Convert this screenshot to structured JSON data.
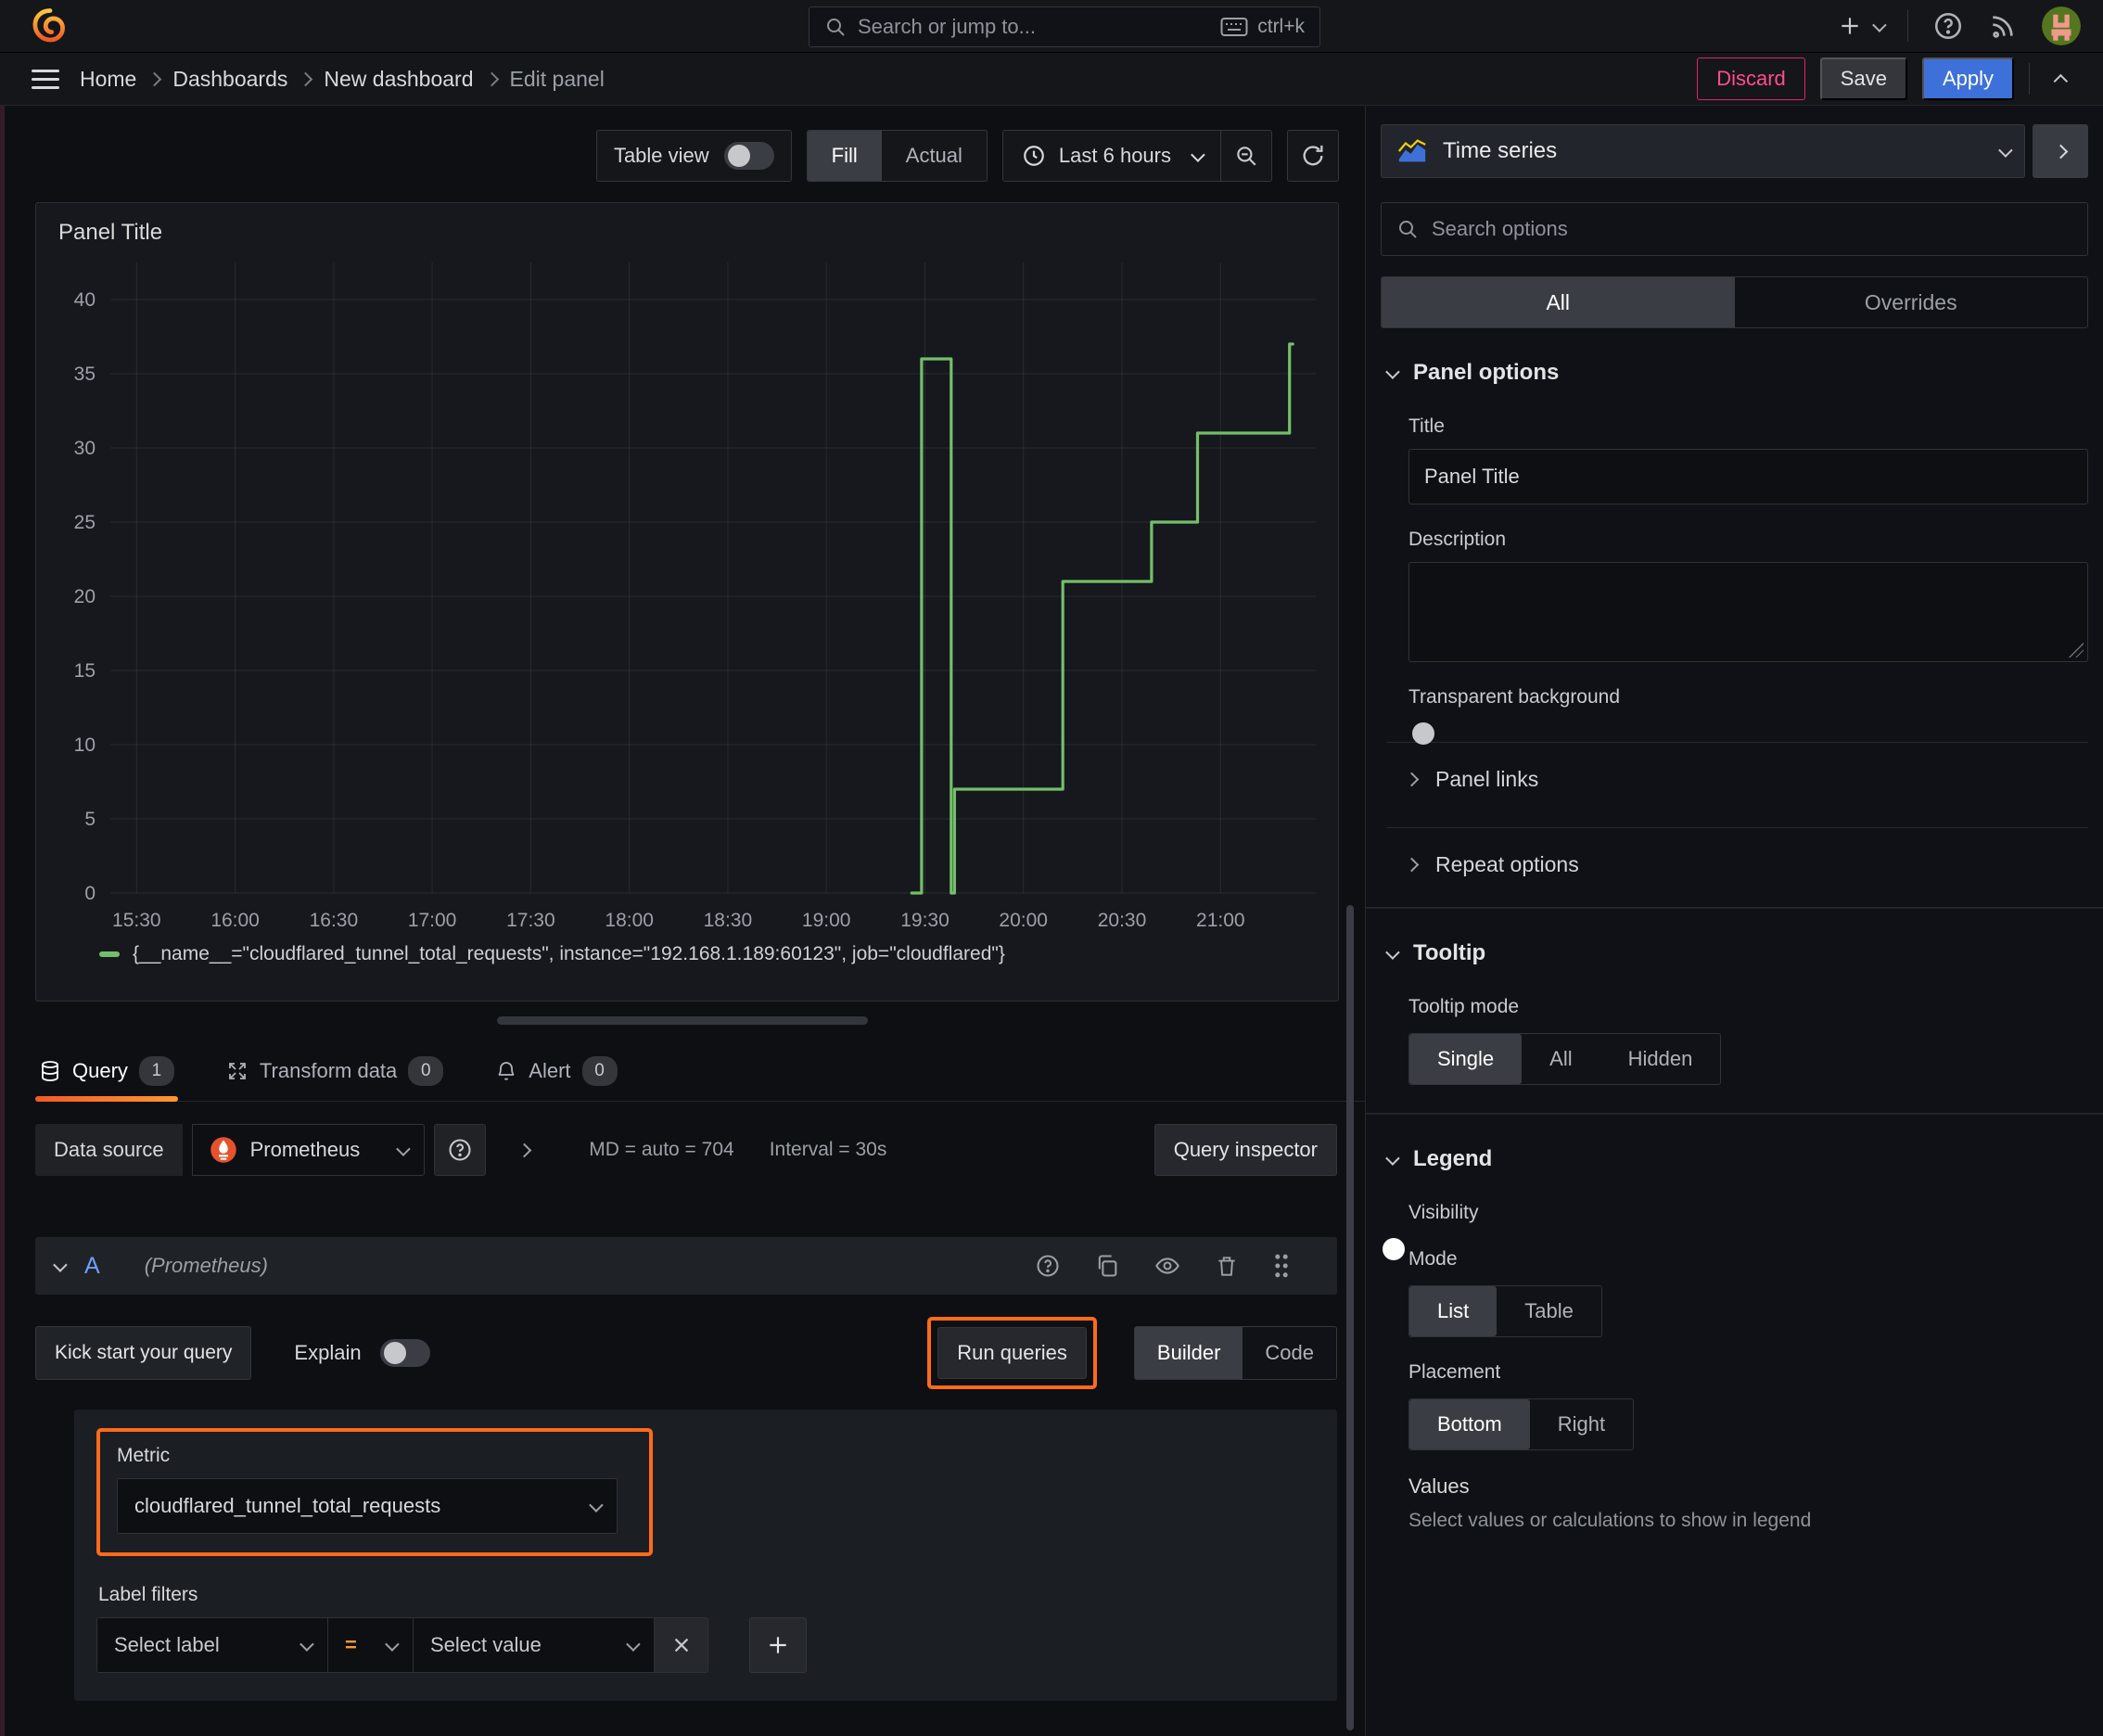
{
  "topbar": {
    "search_placeholder": "Search or jump to...",
    "search_shortcut": "ctrl+k"
  },
  "breadcrumb": {
    "items": [
      "Home",
      "Dashboards",
      "New dashboard",
      "Edit panel"
    ]
  },
  "actions": {
    "discard": "Discard",
    "save": "Save",
    "apply": "Apply"
  },
  "toolbar": {
    "table_view": "Table view",
    "fill": "Fill",
    "actual": "Actual",
    "time_range": "Last 6 hours"
  },
  "panel": {
    "title": "Panel Title"
  },
  "chart_data": {
    "type": "line",
    "title": "Panel Title",
    "x_unit": "minutes since 15:30",
    "xmin": -8,
    "xmax": 359,
    "ymin": 0,
    "ymax": 42.5,
    "xticks": [
      0,
      30,
      60,
      90,
      120,
      150,
      180,
      210,
      240,
      270,
      300,
      330
    ],
    "xtick_labels": [
      "15:30",
      "16:00",
      "16:30",
      "17:00",
      "17:30",
      "18:00",
      "18:30",
      "19:00",
      "19:30",
      "20:00",
      "20:30",
      "21:00"
    ],
    "yticks": [
      0,
      5,
      10,
      15,
      20,
      25,
      30,
      35,
      40
    ],
    "grid": true,
    "legend_position": "bottom",
    "series": [
      {
        "name": "{__name__=\"cloudflared_tunnel_total_requests\", instance=\"192.168.1.189:60123\", job=\"cloudflared\"}",
        "color": "#73bf69",
        "points": [
          [
            236,
            0
          ],
          [
            239,
            0
          ],
          [
            239,
            36
          ],
          [
            248,
            36
          ],
          [
            248,
            0
          ],
          [
            249,
            0
          ],
          [
            249,
            7
          ],
          [
            282,
            7
          ],
          [
            282,
            21
          ],
          [
            309,
            21
          ],
          [
            309,
            25
          ],
          [
            323,
            25
          ],
          [
            323,
            31
          ],
          [
            351,
            31
          ],
          [
            351,
            37
          ],
          [
            352,
            37
          ]
        ]
      }
    ]
  },
  "query_section": {
    "tabs": [
      {
        "label": "Query",
        "badge": "1"
      },
      {
        "label": "Transform data",
        "badge": "0"
      },
      {
        "label": "Alert",
        "badge": "0"
      }
    ],
    "datasource_label": "Data source",
    "datasource": "Prometheus",
    "max_data_points": "MD = auto = 704",
    "interval": "Interval = 30s",
    "inspector": "Query inspector",
    "ref_id": "A",
    "ref_note": "(Prometheus)",
    "kickstart": "Kick start your query",
    "explain": "Explain",
    "run_queries": "Run queries",
    "builder": "Builder",
    "code": "Code",
    "metric_label": "Metric",
    "metric_value": "cloudflared_tunnel_total_requests",
    "label_filters": "Label filters",
    "select_label": "Select label",
    "operator": "=",
    "select_value": "Select value"
  },
  "options": {
    "viz_type": "Time series",
    "search_placeholder": "Search options",
    "tab_all": "All",
    "tab_overrides": "Overrides",
    "panel_options": {
      "header": "Panel options",
      "title_label": "Title",
      "title_value": "Panel Title",
      "description_label": "Description",
      "transparent_label": "Transparent background"
    },
    "collapsed": {
      "panel_links": "Panel links",
      "repeat_options": "Repeat options"
    },
    "tooltip": {
      "header": "Tooltip",
      "mode_label": "Tooltip mode",
      "modes": [
        "Single",
        "All",
        "Hidden"
      ],
      "selected": "Single"
    },
    "legend": {
      "header": "Legend",
      "visibility_label": "Visibility",
      "mode_label": "Mode",
      "modes": [
        "List",
        "Table"
      ],
      "selected_mode": "List",
      "placement_label": "Placement",
      "placements": [
        "Bottom",
        "Right"
      ],
      "selected_placement": "Bottom",
      "values_label": "Values",
      "values_help": "Select values or calculations to show in legend"
    }
  },
  "colors": {
    "accent_blue": "#3d71d9",
    "danger_pink": "#e0226e",
    "highlight_orange": "#ff6b1a",
    "series_green": "#73bf69",
    "prometheus_orange": "#e6522c",
    "tab_underline": "#ff780a"
  }
}
